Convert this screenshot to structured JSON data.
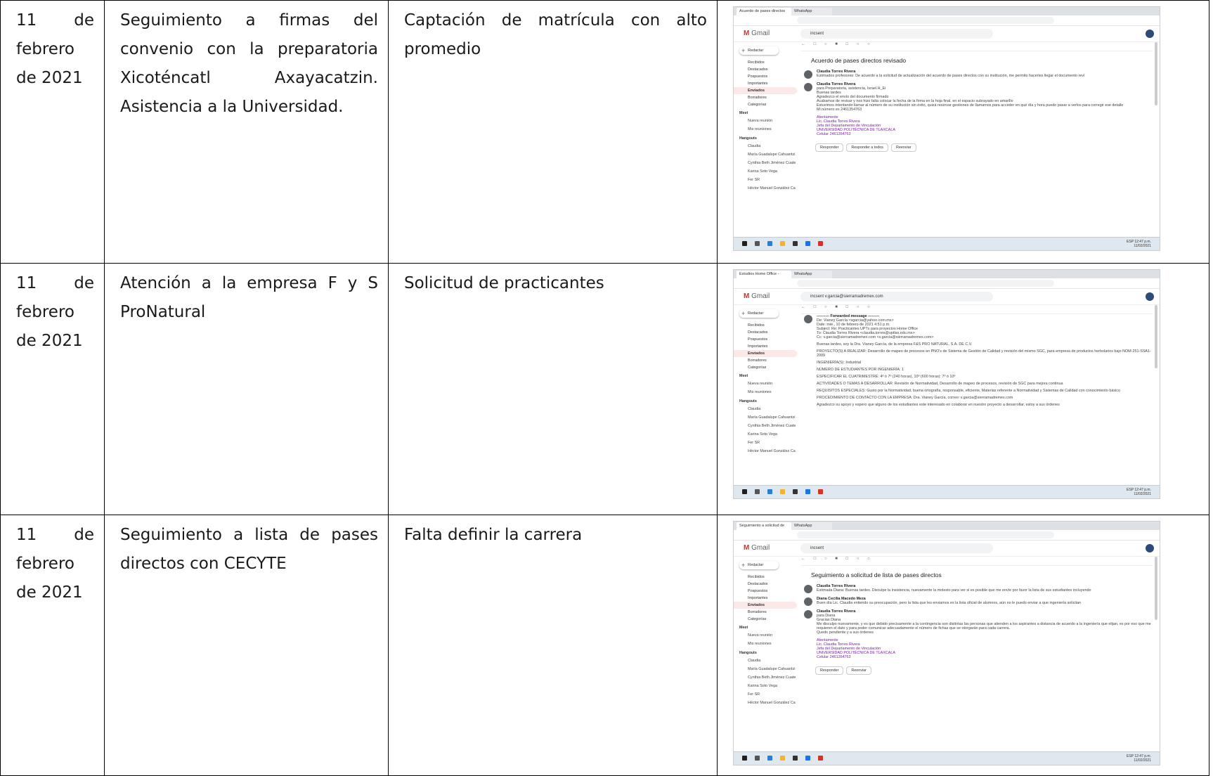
{
  "rows": [
    {
      "date_lines": [
        "11 de",
        "febrero",
        "de 2021"
      ],
      "activity_lines": [
        "Seguimiento a firmas del",
        "convenio con la preparatoria",
        "Xicoténcatl Axayacatzin.",
        "Asistencia a la Universidad."
      ],
      "result_lines": [
        "Captación de matrícula con alto",
        "promedio"
      ],
      "screenshot": {
        "tab1": "Acuerdo de pases directos re...",
        "tab2": "WhatsApp",
        "search_value": "incsent",
        "subject": "Acuerdo de pases directos revisado",
        "messages": [
          {
            "from": "Claudia Torres Rivera",
            "lines": [
              "Estimados profesores: De acuerdo a la solicitud de actualización del acuerdo de pases directos con su institución, me permito hacerles llegar el documento revi"
            ]
          },
          {
            "from": "Claudia Torres Rivera",
            "lines": [
              "para Preparatoria, asistencia, Israel.H_Ei",
              "Buenas tardes",
              "Agradezco el envío del documento firmado",
              "Acabamos de revisar y nos hizo falta colocar la fecha de la firma en la hoja final, en el espacio subrayado en amarillo",
              "Estuvimos intentando llamar al número de su institución sin éxito, quizá reservar gestiones de llamamos para acceder en qué día y hora puedo pasar a verlos para corregir ese detalle",
              "Mi número es 2461354763"
            ],
            "signature": [
              "Atentamente",
              "Lic. Claudia Torres Rivera",
              "Jefa del Departamento de Vinculación",
              "UNIVERSIDAD POLITÉCNICA DE TLAXCALA",
              "Celular 2461354763"
            ]
          }
        ],
        "reply_buttons": [
          "Responder",
          "Responder a todos",
          "Reenviar"
        ]
      }
    },
    {
      "date_lines": [
        "11 de",
        "febrero",
        "de 2021"
      ],
      "activity_lines": [
        "Atención a la empresa F y S",
        "ProNatural"
      ],
      "result_lines": [
        "Solicitud de practicantes"
      ],
      "screenshot": {
        "tab1": "Estudios Home Office - clau...",
        "tab2": "WhatsApp",
        "search_value": "incsent v.garcia@sierramadremex.com",
        "subject": "",
        "messages": [
          {
            "from": "---------- Forwarded message ---------",
            "lines": [
              "De: Vianey García <vgarcia@yahoo.com.mx>",
              "Date: mié., 10 de febrero de 2021 4:51 p.m.",
              "Subject: Re: Practicantes UPTx para proyectos Home Office",
              "To: Claudia Torres Rivera <claudia.torres@uptlax.edu.mx>",
              "Cc: v.garcia@sierramadremex.com <v.garcia@sierramadremex.com>",
              "",
              "Buenas tardes, soy la Dra. Vianey García, de la empresa F&S PRO NATURAL, S.A. DE C.V.",
              "",
              "PROYECTO(S) A REALIZAR: Desarrollo de mapeo de procesos en PNO's de Sistema de Gestión de Calidad y revisión del mismo SGC, para empresa de productos herbolarios bajo NOM-251-SSA1-2009",
              "",
              "INGENIERÍA(S): Industrial",
              "",
              "NÚMERO DE ESTUDIANTES POR INGENIERÍA: 1",
              "",
              "ESPECIFICAR EL CUATRIMESTRE: 4º ó 7º (240 horas), 10º (600 horas): 7º ó 10º",
              "",
              "ACTIVIDADES O TEMAS A DESARROLLAR: Revisión de Normatividad, Desarrollo de mapeo de procesos, revisión de SGC para mejora continua",
              "",
              "REQUISITOS ESPECIALES: Gusto por la Normatividad, buena ortografía, responsable, eficiente, Materias referente a Normatividad y Sistemas de Calidad con conocimiento básico",
              "",
              "PROCEDIMIENTO DE CONTACTO CON LA EMPRESA: Dra. Vianey García, correo: v.garcia@sierramadremex.com",
              "",
              "Agradezco su apoyo y espero que alguno de los estudiantes este interesado en colaborar en nuestro proyecto a desarrollar, estoy a sus órdenes"
            ]
          }
        ],
        "reply_buttons": []
      }
    },
    {
      "date_lines": [
        "11 de",
        "febrero",
        "de 2021"
      ],
      "activity_lines": [
        "Seguimiento a lista de pases",
        "directos con CECYTE"
      ],
      "result_lines": [
        "Falta definir la carrera"
      ],
      "screenshot": {
        "tab1": "Seguimiento a solicitud de lis...",
        "tab2": "WhatsApp",
        "search_value": "incsent",
        "subject": "Seguimiento a solicitud de lista de pases directos",
        "messages": [
          {
            "from": "Claudia Torres Rivera",
            "lines": [
              "Estimada Diana: Buenas tardes. Disculpe la insistencia, nuevamente la molesto para ver si es posible que me envíe por favor la lista de sus estudiantes incluyendo"
            ]
          },
          {
            "from": "Diana Cecilia Macedo Meza",
            "lines": [
              "Buen día Lic. Claudia entiendo su preocupación, pero la lista que les enviamos es la lista oficial de alumnos, aún no le puedo enviar a que ingeniería solicitan"
            ]
          },
          {
            "from": "Claudia Torres Rivera",
            "lines": [
              "para Diana",
              "Gracias Diana",
              "Me disculpo nuevamente, y es que debido precisamente a la contingencia son distintas las personas que atienden a los aspirantes a distancia de acuerdo a la ingeniería que elijan, es por eso que me requieren el dato y para poder comunicar adecuadamente el número de fichas que se otorgarán para cada carrera.",
              "Quedo pendiente y a sus órdenes"
            ],
            "signature": [
              "Atentamente",
              "Lic. Claudia Torres Rivera",
              "Jefa del Departamento de Vinculación",
              "UNIVERSIDAD POLITÉCNICA DE TLAXCALA",
              "Celular 2461354763"
            ]
          }
        ],
        "reply_buttons": [
          "Responder",
          "Reenviar"
        ]
      }
    }
  ],
  "gmail_common": {
    "brand": "Gmail",
    "compose_label": "Redactar",
    "nav": [
      "Recibidos",
      "Destacados",
      "Pospuestos",
      "Importantes",
      "Enviados",
      "Borradores",
      "Categorías"
    ],
    "meet_label": "Meet",
    "meet_items": [
      "Nueva reunión",
      "Mis reuniones"
    ],
    "hangouts_label": "Hangouts",
    "contacts": [
      "Claudia",
      "María Guadalupe Cahuantzi",
      "Cynthia Beth Jiménez Cuate",
      "Karina Soto Vega",
      "Fer SR",
      "Héctor Manuel González Ca"
    ],
    "taskbar_lang": "ESP",
    "taskbar_time": "12:47 p.m.",
    "taskbar_date": "11/02/2021"
  }
}
